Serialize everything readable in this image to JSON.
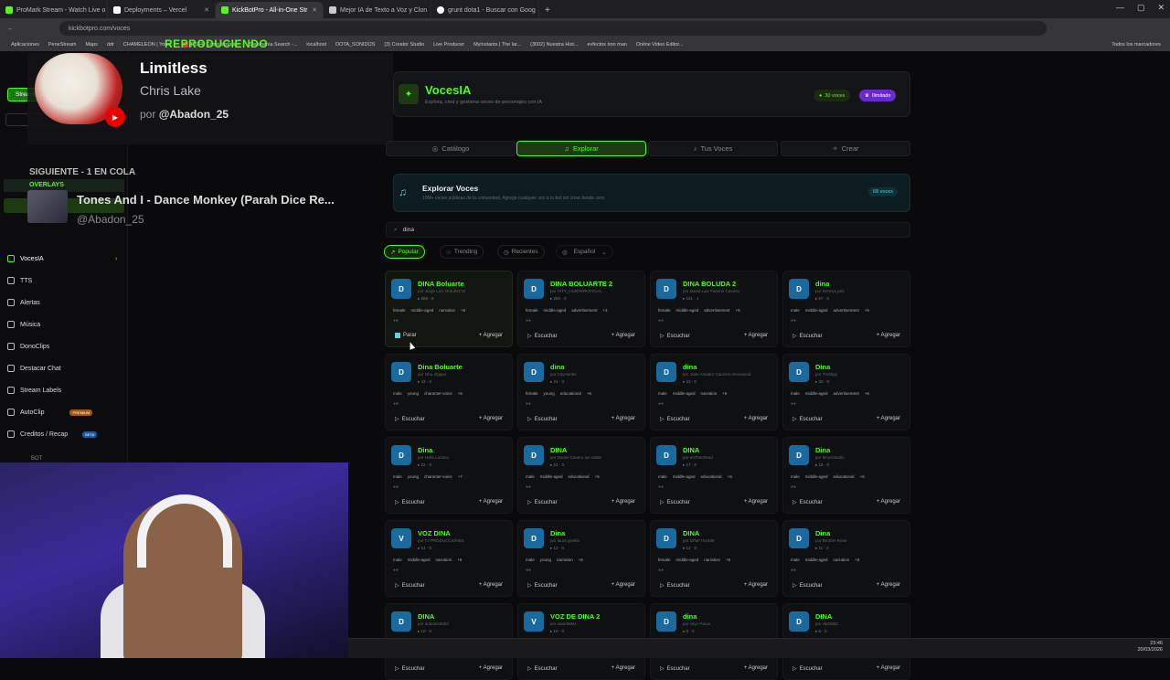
{
  "browser": {
    "tabs": [
      {
        "label": "ProMark Stream - Watch Live o",
        "active": false
      },
      {
        "label": "Deployments – Vercel",
        "active": false
      },
      {
        "label": "KickBotPro - All-in-One Str",
        "active": true
      },
      {
        "label": "Mejor IA de Texto a Voz y Clon",
        "active": false
      },
      {
        "label": "grunt dota1 - Buscar con Goog",
        "active": false
      }
    ],
    "url": "kickbotpro.com/voces",
    "bookmarks": [
      "Aplicaciones",
      "PeneStream",
      "Maps",
      "ddr",
      "CHAMELEON | Your...",
      "(1144) Cómo instala...",
      "Stepmania Search -...",
      "localhost",
      "DOTA_SONIDOS",
      "(3) Creator Studio",
      "Live Producer",
      "Myinstants | The lar...",
      "(3002) Nuestra Hist...",
      "evfectos iron man",
      "Online Video Editor...",
      "Todos los marcadores"
    ]
  },
  "nowplaying": {
    "label": "REPRODUCIENDO",
    "title": "Limitless",
    "artist": "Chris Lake",
    "by_prefix": "por",
    "by_user": "@Abadon_25"
  },
  "queue": {
    "label": "SIGUIENTE - 1 EN COLA",
    "title": "Tones And I - Dance Monkey (Parah Dice Re...",
    "by": "@Abadon_25"
  },
  "sidebar": {
    "streamer_label": "Streamer",
    "overlays_label": "OVERLAYS",
    "items": [
      {
        "label": "VocesIA",
        "active": true
      },
      {
        "label": "TTS"
      },
      {
        "label": "Alertas"
      },
      {
        "label": "Música"
      },
      {
        "label": "DonoClips"
      },
      {
        "label": "Destacar Chat"
      },
      {
        "label": "Stream Labels"
      },
      {
        "label": "AutoClip",
        "badge": "PREMIUM"
      },
      {
        "label": "Creditos / Recap",
        "badge": "BETA"
      },
      {
        "label": "BOT"
      }
    ]
  },
  "header": {
    "title": "VocesIA",
    "subtitle": "Explora, crea y gestiona voces de personajes con IA",
    "voices_pill": "30 voces",
    "plan_pill": "Ilimitado"
  },
  "nav": [
    "Catálogo",
    "Explorar",
    "Tus Voces",
    "Crear"
  ],
  "explore": {
    "title": "Explorar Voces",
    "subtitle": "10M+ voces públicas de la comunidad. Agrega cualquier voz a tu bot sin crear desde cero.",
    "badge": "68 voces"
  },
  "search": {
    "value": "dina"
  },
  "filters": [
    "Popular",
    "Trending",
    "Recientes",
    "Español"
  ],
  "actions": {
    "listen": "Escuchar",
    "stop": "Parar",
    "add": "Agregar"
  },
  "voices": [
    {
      "name": "DINA Boluarte",
      "author": "por Jorge Luis Ordoñez M",
      "stats": "808 · 9",
      "tags": [
        "female",
        "middle-aged",
        "narration",
        "+5"
      ],
      "playing": true
    },
    {
      "name": "DINA BOLUARTE 2",
      "author": "por CITY_HUNTEROFICIAL",
      "stats": "290 · 0",
      "tags": [
        "female",
        "middle-aged",
        "advertisement",
        "+4"
      ]
    },
    {
      "name": "DINA BOLUDA 2",
      "author": "por David Luis Pancho Caverio",
      "stats": "141 · 1",
      "tags": [
        "female",
        "middle-aged",
        "advertisement",
        "+5"
      ]
    },
    {
      "name": "dina",
      "author": "por Dennys priz",
      "stats": "57 · 0",
      "tags": [
        "male",
        "middle-aged",
        "advertisement",
        "+5"
      ]
    },
    {
      "name": "Dina Boluarte",
      "author": "por Ghu Algapo",
      "stats": "43 · 0",
      "tags": [
        "male",
        "young",
        "character-voice",
        "+6"
      ]
    },
    {
      "name": "dina",
      "author": "por CityHunter",
      "stats": "24 · 0",
      "tags": [
        "female",
        "young",
        "educational",
        "+6"
      ]
    },
    {
      "name": "dina",
      "author": "por Juan Amador Cáceres Almonacid",
      "stats": "23 · 0",
      "tags": [
        "male",
        "middle-aged",
        "narration",
        "+6"
      ]
    },
    {
      "name": "Dina",
      "author": "por TOShpy",
      "stats": "20 · 0",
      "tags": [
        "male",
        "middle-aged",
        "advertisement",
        "+6"
      ]
    },
    {
      "name": "Dina",
      "author": "por Hollo Lozano",
      "stats": "22 · 0",
      "tags": [
        "male",
        "young",
        "character-voice",
        "+7"
      ]
    },
    {
      "name": "DINA",
      "author": "por Daniel Cavero Iue Iatale",
      "stats": "21 · 0",
      "tags": [
        "male",
        "middle-aged",
        "educational",
        "+5"
      ]
    },
    {
      "name": "DINA",
      "author": "por e07be00ead",
      "stats": "17 · 0",
      "tags": [
        "male",
        "middle-aged",
        "educational",
        "+6"
      ]
    },
    {
      "name": "Dina",
      "author": "por lenosistudio",
      "stats": "16 · 0",
      "tags": [
        "male",
        "middle-aged",
        "educational",
        "+6"
      ]
    },
    {
      "name": "VOZ DINA",
      "author": "por TJ PRODUCCIONES",
      "stats": "14 · 0",
      "tags": [
        "male",
        "middle-aged",
        "narration",
        "+6"
      ]
    },
    {
      "name": "Dina",
      "author": "por laura gisella",
      "stats": "12 · 0",
      "tags": [
        "male",
        "young",
        "narration",
        "+6"
      ]
    },
    {
      "name": "DINA",
      "author": "por DrfaF7S2489",
      "stats": "12 · 0",
      "tags": [
        "female",
        "middle-aged",
        "narration",
        "+6"
      ]
    },
    {
      "name": "Dina",
      "author": "por Brother Rone",
      "stats": "11 · 0",
      "tags": [
        "male",
        "middle-aged",
        "narration",
        "+6"
      ]
    },
    {
      "name": "DINA",
      "author": "por dobal24600d",
      "stats": "10 · 0",
      "tags": []
    },
    {
      "name": "VOZ DE DINA 2",
      "author": "por standMM4",
      "stats": "10 · 0",
      "tags": []
    },
    {
      "name": "dina",
      "author": "por Glyn Paron",
      "stats": "8 · 0",
      "tags": []
    },
    {
      "name": "DINA",
      "author": "por vlpt3882",
      "stats": "6 · 0",
      "tags": []
    }
  ],
  "clock": {
    "time": "23:46",
    "date": "20/03/2026"
  }
}
